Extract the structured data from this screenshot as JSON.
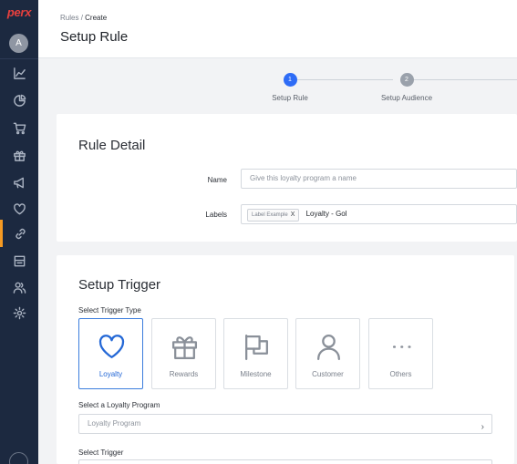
{
  "app": {
    "logo": "perx",
    "avatar_initial": "A"
  },
  "sidebar": {
    "items": [
      {
        "icon": "chart-line-icon"
      },
      {
        "icon": "pie-chart-icon"
      },
      {
        "icon": "cart-icon"
      },
      {
        "icon": "gift-icon"
      },
      {
        "icon": "megaphone-icon"
      },
      {
        "icon": "heart-icon"
      },
      {
        "icon": "link-icon",
        "active": true
      },
      {
        "icon": "store-icon"
      },
      {
        "icon": "users-icon"
      },
      {
        "icon": "gear-icon"
      }
    ],
    "accent": "#f59a23"
  },
  "header": {
    "breadcrumb": {
      "root": "Rules",
      "separator": "/",
      "current": "Create"
    },
    "title": "Setup Rule"
  },
  "stepper": {
    "steps": [
      {
        "number": "1",
        "label": "Setup Rule",
        "status": "active",
        "color": "#2e6cf6"
      },
      {
        "number": "2",
        "label": "Setup Audience",
        "status": "pending",
        "color": "#9aa1ab"
      }
    ]
  },
  "rule_detail": {
    "title": "Rule Detail",
    "name_label": "Name",
    "name_placeholder": "Give this loyalty program a name",
    "labels_label": "Labels",
    "tag_text": "Label Example",
    "tag_remove": "X",
    "labels_value": "Loyalty - Gol"
  },
  "setup_trigger": {
    "title": "Setup Trigger",
    "type_label": "Select Trigger Type",
    "types": [
      {
        "label": "Loyalty",
        "icon": "heart-icon",
        "selected": true
      },
      {
        "label": "Rewards",
        "icon": "gift-icon",
        "selected": false
      },
      {
        "label": "Milestone",
        "icon": "flag-icon",
        "selected": false
      },
      {
        "label": "Customer",
        "icon": "person-icon",
        "selected": false
      },
      {
        "label": "Others",
        "icon": "more-dots-icon",
        "selected": false
      }
    ],
    "program_label": "Select a Loyalty Program",
    "program_placeholder": "Loyalty Program",
    "program_chevron": "›",
    "trigger_label": "Select Trigger"
  }
}
